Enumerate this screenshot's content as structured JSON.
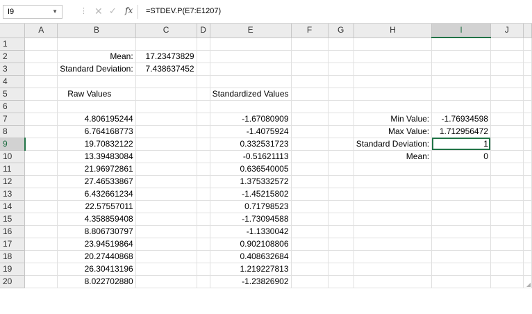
{
  "name_box": "I9",
  "formula": "=STDEV.P(E7:E1207)",
  "icons": [
    "dropdown-arrow-icon",
    "cancel-icon",
    "enter-icon",
    "function-icon"
  ],
  "colors": {
    "accent": "#217346",
    "header_bg": "#ececec",
    "gridline": "#e0e0e0"
  },
  "columns": [
    "A",
    "B",
    "C",
    "D",
    "E",
    "F",
    "G",
    "H",
    "I",
    "J"
  ],
  "selected_column": "I",
  "selected_row": "9",
  "rows": [
    {
      "num": "1",
      "B": "",
      "C": "",
      "E": "",
      "H": "",
      "I": ""
    },
    {
      "num": "2",
      "B": "Mean:",
      "C": "17.23473829",
      "E": "",
      "H": "",
      "I": ""
    },
    {
      "num": "3",
      "B": "Standard Deviation:",
      "C": "7.438637452",
      "E": "",
      "H": "",
      "I": ""
    },
    {
      "num": "4",
      "B": "",
      "C": "",
      "E": "",
      "H": "",
      "I": ""
    },
    {
      "num": "5",
      "B": "Raw Values",
      "C": "",
      "E": "Standardized Values",
      "H": "",
      "I": ""
    },
    {
      "num": "6",
      "B": "",
      "C": "",
      "E": "",
      "H": "",
      "I": ""
    },
    {
      "num": "7",
      "B": "4.806195244",
      "C": "",
      "E": "-1.67080909",
      "H": "Min Value:",
      "I": "-1.76934598"
    },
    {
      "num": "8",
      "B": "6.764168773",
      "C": "",
      "E": "-1.4075924",
      "H": "Max Value:",
      "I": "1.712956472"
    },
    {
      "num": "9",
      "B": "19.70832122",
      "C": "",
      "E": "0.332531723",
      "H": "Standard Deviation:",
      "I": "1"
    },
    {
      "num": "10",
      "B": "13.39483084",
      "C": "",
      "E": "-0.51621113",
      "H": "Mean:",
      "I": "0"
    },
    {
      "num": "11",
      "B": "21.96972861",
      "C": "",
      "E": "0.636540005",
      "H": "",
      "I": ""
    },
    {
      "num": "12",
      "B": "27.46533867",
      "C": "",
      "E": "1.375332572",
      "H": "",
      "I": ""
    },
    {
      "num": "13",
      "B": "6.432661234",
      "C": "",
      "E": "-1.45215802",
      "H": "",
      "I": ""
    },
    {
      "num": "14",
      "B": "22.57557011",
      "C": "",
      "E": "0.71798523",
      "H": "",
      "I": ""
    },
    {
      "num": "15",
      "B": "4.358859408",
      "C": "",
      "E": "-1.73094588",
      "H": "",
      "I": ""
    },
    {
      "num": "16",
      "B": "8.806730797",
      "C": "",
      "E": "-1.1330042",
      "H": "",
      "I": ""
    },
    {
      "num": "17",
      "B": "23.94519864",
      "C": "",
      "E": "0.902108806",
      "H": "",
      "I": ""
    },
    {
      "num": "18",
      "B": "20.27440868",
      "C": "",
      "E": "0.408632684",
      "H": "",
      "I": ""
    },
    {
      "num": "19",
      "B": "26.30413196",
      "C": "",
      "E": "1.219227813",
      "H": "",
      "I": ""
    },
    {
      "num": "20",
      "B": "8.022702880",
      "C": "",
      "E": "-1.23826902",
      "H": "",
      "I": ""
    }
  ]
}
